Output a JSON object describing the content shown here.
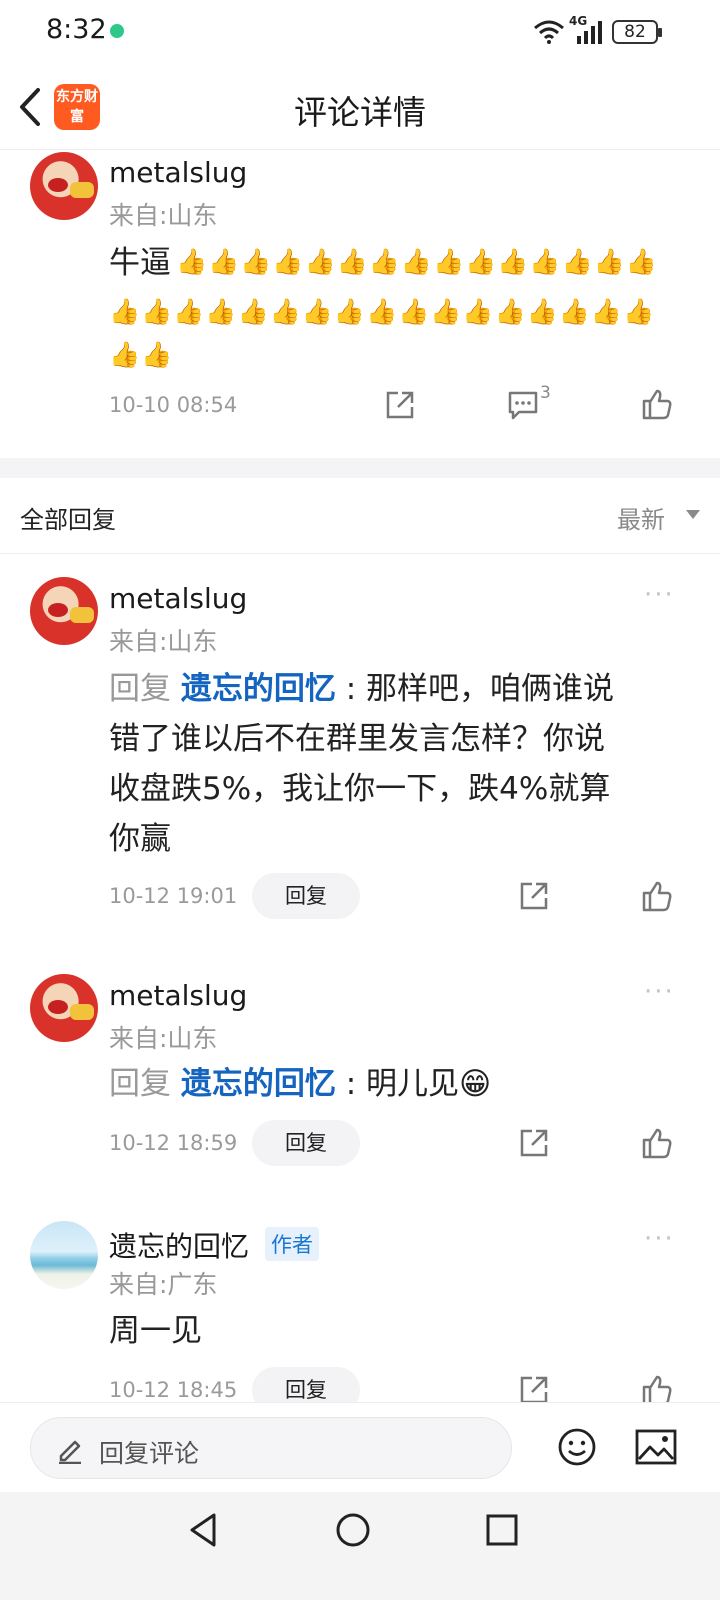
{
  "status_bar": {
    "time": "8:32",
    "network": "4G",
    "battery": "82"
  },
  "header": {
    "app_logo_text": "东方财富",
    "title": "评论详情"
  },
  "main_comment": {
    "username": "metalslug",
    "location": "来自:山东",
    "text": "牛逼",
    "thumbs_line1": "👍👍👍👍👍👍👍👍👍👍👍👍👍👍👍",
    "thumbs_line2": "👍👍👍👍👍👍👍👍👍👍👍👍👍👍👍👍👍",
    "thumbs_line3": "👍👍",
    "time": "10-10 08:54",
    "reply_count": "3"
  },
  "replies_header": {
    "title": "全部回复",
    "sort": "最新"
  },
  "replies": [
    {
      "username": "metalslug",
      "location": "来自:山东",
      "reply_prefix": "回复",
      "mention": "遗忘的回忆",
      "line1": " : 那样吧，咱俩谁说",
      "line2": "错了谁以后不在群里发言怎样？你说",
      "line3": "收盘跌5%，我让你一下，跌4%就算",
      "line4": "你赢",
      "time": "10-12 19:01",
      "reply_label": "回复"
    },
    {
      "username": "metalslug",
      "location": "来自:山东",
      "reply_prefix": "回复",
      "mention": "遗忘的回忆",
      "line1": " : 明儿见😁",
      "time": "10-12 18:59",
      "reply_label": "回复"
    },
    {
      "username": "遗忘的回忆",
      "badge": "作者",
      "location": "来自:广东",
      "line1": "周一见",
      "time": "10-12 18:45",
      "reply_label": "回复"
    }
  ],
  "more_label": "···",
  "bottom_bar": {
    "placeholder": "回复评论"
  },
  "icons": [
    "back-icon",
    "share-icon",
    "comment-icon",
    "like-icon",
    "more-icon",
    "edit-icon",
    "emoji-icon",
    "image-icon"
  ],
  "colors": {
    "accent_link": "#1565c0",
    "logo": "#ff5a1f",
    "author_badge": "#1976d2"
  }
}
